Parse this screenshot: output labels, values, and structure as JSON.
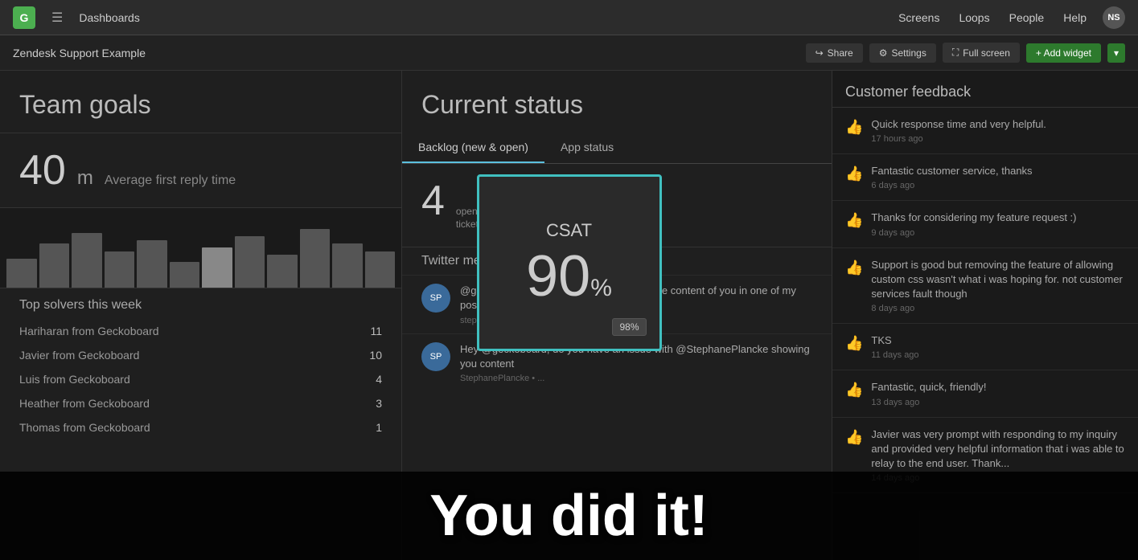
{
  "topNav": {
    "logo": "G",
    "hamburgerLabel": "☰",
    "title": "Dashboards",
    "links": [
      "Screens",
      "Loops",
      "People",
      "Help"
    ],
    "avatarInitials": "NS"
  },
  "dashboardBar": {
    "title": "Zendesk Support Example",
    "shareLabel": "Share",
    "settingsLabel": "Settings",
    "fullscreenLabel": "Full screen",
    "addWidgetLabel": "+ Add widget"
  },
  "leftPanel": {
    "title": "Team goals",
    "metric": "40",
    "metricUnit": "m",
    "metricLabel": "Average first reply time",
    "topSolversTitle": "Top solvers this week",
    "solvers": [
      {
        "name": "Hariharan from Geckoboard",
        "count": 11
      },
      {
        "name": "Javier from Geckoboard",
        "count": 10
      },
      {
        "name": "Luis from Geckoboard",
        "count": 4
      },
      {
        "name": "Heather from Geckoboard",
        "count": 3
      },
      {
        "name": "Thomas from Geckoboard",
        "count": 1
      }
    ],
    "chartBars": [
      30,
      45,
      60,
      40,
      55,
      35,
      50,
      65,
      45,
      70,
      55,
      40
    ]
  },
  "centerPanel": {
    "title": "Current status",
    "tabs": [
      "Backlog (new & open)",
      "App status"
    ],
    "activeTab": 0,
    "statusMetric": "4",
    "statusLabel1": "open",
    "statusLabel2": "tickets",
    "twitterTitle": "Twitter me",
    "tweets": [
      {
        "avatarText": "SP",
        "text": "@geckoboard Hi I am sorry that I used some content of you in one of my post I removed it. Again sorry.",
        "meta": "stephane plancke • a day ago"
      },
      {
        "avatarText": "SP",
        "text": "Hey @geckoboard, do you have an issue with @StephanePlancke showing you content",
        "meta": "StephanePlancke • ..."
      }
    ]
  },
  "rightPanel": {
    "title": "Customer feedback",
    "items": [
      {
        "text": "Quick response time and very helpful.",
        "time": "17 hours ago"
      },
      {
        "text": "Fantastic customer service, thanks",
        "time": "6 days ago"
      },
      {
        "text": "Thanks for considering my feature request :)",
        "time": "9 days ago"
      },
      {
        "text": "Support is good but removing the feature of allowing custom css wasn't what i was hoping for. not customer services fault though",
        "time": "8 days ago"
      },
      {
        "text": "TKS",
        "time": "11 days ago"
      },
      {
        "text": "Fantastic, quick, friendly!",
        "time": "13 days ago"
      },
      {
        "text": "Javier was very prompt with responding to my inquiry and provided very helpful information that i was able to relay to the end user. Thank...",
        "time": "14 days ago"
      }
    ]
  },
  "csatOverlay": {
    "title": "CSAT",
    "value": "90",
    "percentSymbol": "%",
    "badge": "98%"
  },
  "youDidIt": {
    "text": "You did it!"
  }
}
